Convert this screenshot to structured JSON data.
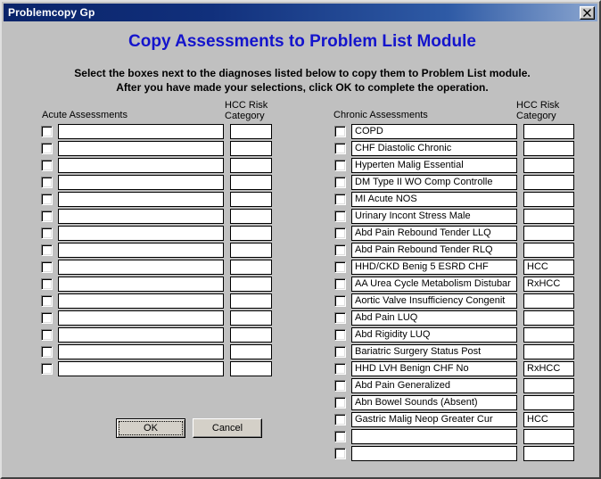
{
  "window": {
    "title": "Problemcopy Gp",
    "close_icon": "close-x-icon"
  },
  "header": {
    "main_title": "Copy Assessments to Problem List Module",
    "instruction_line_1": "Select the boxes next to the diagnoses listed below to copy them to Problem List module.",
    "instruction_line_2": "After you have made your selections, click OK to complete the operation."
  },
  "columns": {
    "acute_label": "Acute Assessments",
    "chronic_label": "Chronic Assessments",
    "hcc_label": "HCC Risk\nCategory"
  },
  "acute_rows": [
    {
      "name": "",
      "hcc": "",
      "checked": false
    },
    {
      "name": "",
      "hcc": "",
      "checked": false
    },
    {
      "name": "",
      "hcc": "",
      "checked": false
    },
    {
      "name": "",
      "hcc": "",
      "checked": false
    },
    {
      "name": "",
      "hcc": "",
      "checked": false
    },
    {
      "name": "",
      "hcc": "",
      "checked": false
    },
    {
      "name": "",
      "hcc": "",
      "checked": false
    },
    {
      "name": "",
      "hcc": "",
      "checked": false
    },
    {
      "name": "",
      "hcc": "",
      "checked": false
    },
    {
      "name": "",
      "hcc": "",
      "checked": false
    },
    {
      "name": "",
      "hcc": "",
      "checked": false
    },
    {
      "name": "",
      "hcc": "",
      "checked": false
    },
    {
      "name": "",
      "hcc": "",
      "checked": false
    },
    {
      "name": "",
      "hcc": "",
      "checked": false
    },
    {
      "name": "",
      "hcc": "",
      "checked": false
    }
  ],
  "chronic_rows": [
    {
      "name": "COPD",
      "hcc": "",
      "checked": false
    },
    {
      "name": "CHF Diastolic Chronic",
      "hcc": "",
      "checked": false
    },
    {
      "name": "Hyperten Malig Essential",
      "hcc": "",
      "checked": false
    },
    {
      "name": "DM  Type II WO Comp Controlle",
      "hcc": "",
      "checked": false
    },
    {
      "name": "MI Acute NOS",
      "hcc": "",
      "checked": false
    },
    {
      "name": "Urinary Incont Stress Male",
      "hcc": "",
      "checked": false
    },
    {
      "name": "Abd Pain Rebound Tender LLQ",
      "hcc": "",
      "checked": false
    },
    {
      "name": "Abd Pain Rebound Tender RLQ",
      "hcc": "",
      "checked": false
    },
    {
      "name": "HHD/CKD Benig 5 ESRD CHF",
      "hcc": "HCC",
      "checked": false
    },
    {
      "name": "AA Urea Cycle Metabolism Distubar",
      "hcc": "RxHCC",
      "checked": false
    },
    {
      "name": "Aortic Valve Insufficiency Congenit",
      "hcc": "",
      "checked": false
    },
    {
      "name": "Abd Pain LUQ",
      "hcc": "",
      "checked": false
    },
    {
      "name": "Abd Rigidity LUQ",
      "hcc": "",
      "checked": false
    },
    {
      "name": "Bariatric Surgery Status Post",
      "hcc": "",
      "checked": false
    },
    {
      "name": "HHD LVH Benign CHF No",
      "hcc": "RxHCC",
      "checked": false
    },
    {
      "name": "Abd Pain Generalized",
      "hcc": "",
      "checked": false
    },
    {
      "name": "Abn Bowel Sounds (Absent)",
      "hcc": "",
      "checked": false
    },
    {
      "name": "Gastric Malig Neop Greater Cur",
      "hcc": "HCC",
      "checked": false
    },
    {
      "name": "",
      "hcc": "",
      "checked": false
    },
    {
      "name": "",
      "hcc": "",
      "checked": false
    }
  ],
  "buttons": {
    "ok_label": "OK",
    "cancel_label": "Cancel"
  },
  "colors": {
    "title_text": "#1414CC",
    "titlebar_start": "#0A246A",
    "dialog_face": "#C0C0C0"
  }
}
